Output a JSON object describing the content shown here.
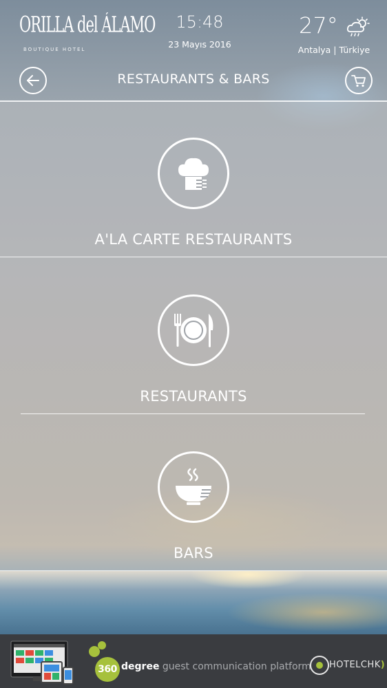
{
  "header": {
    "logo_name": "ORILLA del ÁLAMO",
    "logo_subtitle": "BOUTIQUE HOTEL",
    "time": "15:48",
    "date": "23 Mayıs 2016",
    "temperature": "27°",
    "weather_icon": "partly-cloudy-rain-icon",
    "location": "Antalya | Türkiye",
    "title": "RESTAURANTS & BARS",
    "back_icon": "arrow-left-icon",
    "cart_icon": "shopping-cart-icon"
  },
  "categories": [
    {
      "label": "A'LA CARTE RESTAURANTS",
      "icon": "chef-hat-icon"
    },
    {
      "label": "RESTAURANTS",
      "icon": "plate-cutlery-icon"
    },
    {
      "label": "BARS",
      "icon": "steaming-bowl-icon"
    }
  ],
  "footer": {
    "badge": "360",
    "tagline_bold": "degree",
    "tagline_rest": " guest communication platform",
    "brand": "HOTELCHK",
    "brand_suffix": ")",
    "accent_color": "#a6c13c",
    "background_color": "#3a3c40"
  }
}
